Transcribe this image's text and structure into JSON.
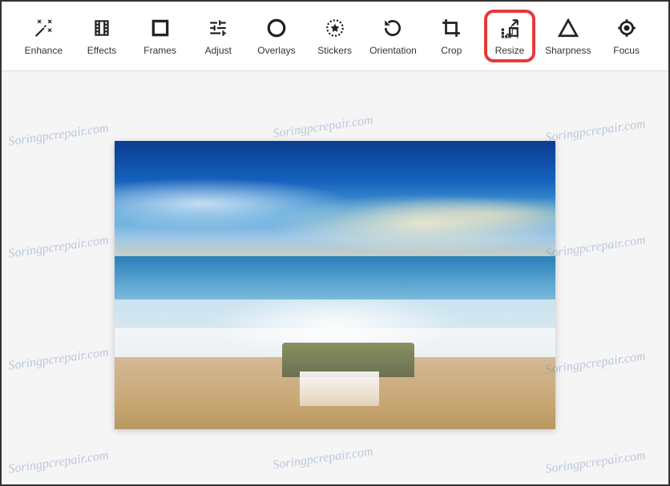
{
  "toolbar": {
    "items": [
      {
        "id": "enhance",
        "label": "Enhance",
        "icon": "magic-wand-icon"
      },
      {
        "id": "effects",
        "label": "Effects",
        "icon": "film-strip-icon"
      },
      {
        "id": "frames",
        "label": "Frames",
        "icon": "square-icon"
      },
      {
        "id": "adjust",
        "label": "Adjust",
        "icon": "sliders-icon"
      },
      {
        "id": "overlays",
        "label": "Overlays",
        "icon": "circle-icon"
      },
      {
        "id": "stickers",
        "label": "Stickers",
        "icon": "star-badge-icon"
      },
      {
        "id": "orientation",
        "label": "Orientation",
        "icon": "rotate-icon"
      },
      {
        "id": "crop",
        "label": "Crop",
        "icon": "crop-icon"
      },
      {
        "id": "resize",
        "label": "Resize",
        "icon": "resize-icon",
        "highlighted": true
      },
      {
        "id": "sharpness",
        "label": "Sharpness",
        "icon": "triangle-icon"
      },
      {
        "id": "focus",
        "label": "Focus",
        "icon": "target-icon"
      }
    ]
  },
  "watermark": "Soringpcrepair.com"
}
